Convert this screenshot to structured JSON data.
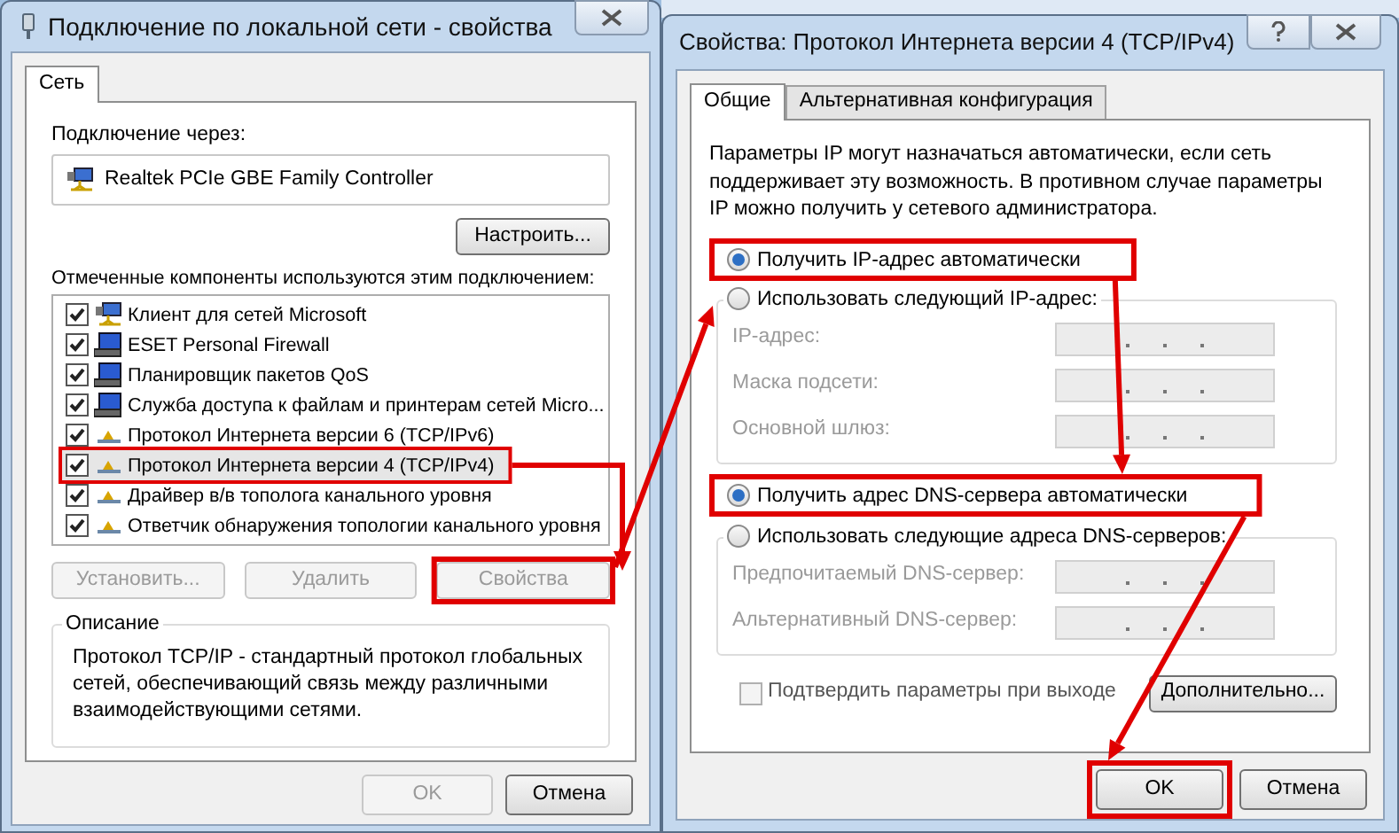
{
  "left_dialog": {
    "title": "Подключение по локальной сети - свойства",
    "tabs": [
      {
        "label": "Сеть",
        "selected": true
      }
    ],
    "connect_via_label": "Подключение через:",
    "adapter": "Realtek PCIe GBE Family Controller",
    "configure_button": "Настроить...",
    "components_label": "Отмеченные компоненты используются этим подключением:",
    "components": [
      {
        "label": "Клиент для сетей Microsoft",
        "checked": true,
        "kind": "client",
        "selected": false
      },
      {
        "label": "ESET Personal Firewall",
        "checked": true,
        "kind": "computer",
        "selected": false
      },
      {
        "label": "Планировщик пакетов QoS",
        "checked": true,
        "kind": "computer",
        "selected": false
      },
      {
        "label": "Служба доступа к файлам и принтерам сетей Micro...",
        "checked": true,
        "kind": "computer",
        "selected": false
      },
      {
        "label": "Протокол Интернета версии 6 (TCP/IPv6)",
        "checked": true,
        "kind": "protocol",
        "selected": false
      },
      {
        "label": "Протокол Интернета версии 4 (TCP/IPv4)",
        "checked": true,
        "kind": "protocol",
        "selected": true
      },
      {
        "label": "Драйвер в/в тополога канального уровня",
        "checked": true,
        "kind": "protocol",
        "selected": false
      },
      {
        "label": "Ответчик обнаружения топологии канального уровня",
        "checked": true,
        "kind": "protocol",
        "selected": false
      }
    ],
    "buttons": [
      {
        "label": "Установить...",
        "disabled": true
      },
      {
        "label": "Удалить",
        "disabled": true
      },
      {
        "label": "Свойства",
        "disabled": true
      }
    ],
    "description": {
      "title": "Описание",
      "text": "Протокол TCP/IP - стандартный протокол глобальных сетей, обеспечивающий связь между различными взаимодействующими сетями."
    },
    "footer_buttons": [
      {
        "label": "OK",
        "disabled": true
      },
      {
        "label": "Отмена",
        "disabled": false
      }
    ]
  },
  "right_dialog": {
    "title": "Свойства: Протокол Интернета версии 4 (TCP/IPv4)",
    "tabs": [
      {
        "label": "Общие",
        "selected": true
      },
      {
        "label": "Альтернативная конфигурация",
        "selected": false
      }
    ],
    "intro": "Параметры IP могут назначаться автоматически, если сеть поддерживает эту возможность. В противном случае параметры IP можно получить у сетевого администратора.",
    "ip_options": [
      {
        "label": "Получить IP-адрес автоматически",
        "selected": true
      },
      {
        "label": "Использовать следующий IP-адрес:",
        "selected": false
      }
    ],
    "ip_fields": [
      {
        "label": "IP-адрес:",
        "disabled": true
      },
      {
        "label": "Маска подсети:",
        "disabled": true
      },
      {
        "label": "Основной шлюз:",
        "disabled": true
      }
    ],
    "dns_options": [
      {
        "label": "Получить адрес DNS-сервера автоматически",
        "selected": true
      },
      {
        "label": "Использовать следующие адреса DNS-серверов:",
        "selected": false
      }
    ],
    "dns_fields": [
      {
        "label": "Предпочитаемый DNS-сервер:",
        "disabled": true
      },
      {
        "label": "Альтернативный DNS-сервер:",
        "disabled": true
      }
    ],
    "confirm_checkbox": {
      "label": "Подтвердить параметры при выходе",
      "checked": false,
      "disabled": true
    },
    "advanced_button": "Дополнительно...",
    "footer_buttons": [
      {
        "label": "OK",
        "disabled": false
      },
      {
        "label": "Отмена",
        "disabled": false
      }
    ]
  }
}
